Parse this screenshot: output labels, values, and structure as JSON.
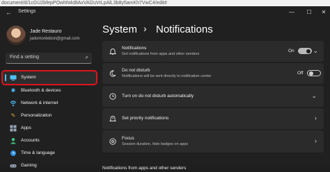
{
  "browser": {
    "url": "document/d/1cGU2bfepPOwhN4d8AxVAl2uVrLpAlL3b8y5amKh7VwC4/edit#"
  },
  "window": {
    "title": "Settings"
  },
  "user": {
    "name": "Jade Restauro",
    "email": "jadomontebon@gmail.com"
  },
  "search": {
    "placeholder": "Find a setting"
  },
  "sidebar": {
    "items": [
      {
        "label": "System",
        "icon": "system-icon",
        "selected": true
      },
      {
        "label": "Bluetooth & devices",
        "icon": "bluetooth-icon"
      },
      {
        "label": "Network & internet",
        "icon": "network-icon"
      },
      {
        "label": "Personalization",
        "icon": "brush-icon"
      },
      {
        "label": "Apps",
        "icon": "apps-icon"
      },
      {
        "label": "Accounts",
        "icon": "accounts-icon"
      },
      {
        "label": "Time & language",
        "icon": "globe-clock-icon"
      },
      {
        "label": "Gaming",
        "icon": "gamepad-icon"
      }
    ]
  },
  "breadcrumb": {
    "parent": "System",
    "separator": "›",
    "current": "Notifications"
  },
  "cards": {
    "notifications": {
      "title": "Notifications",
      "subtitle": "Get notifications from apps and other senders",
      "state": "On"
    },
    "dnd": {
      "title": "Do not disturb",
      "subtitle": "Notifications will be sent directly to notification center",
      "state": "Off"
    },
    "auto_dnd": {
      "title": "Turn on do not disturb automatically"
    },
    "priority": {
      "title": "Set priority notifications"
    },
    "focus": {
      "title": "Focus",
      "subtitle": "Session duration, hide badges on apps"
    }
  },
  "section": {
    "apps_label": "Notifications from apps and other senders"
  },
  "colors": {
    "accent": "#4cc2ff",
    "highlight": "#e0141c",
    "background": "#202020",
    "card": "#2b2b2b"
  }
}
